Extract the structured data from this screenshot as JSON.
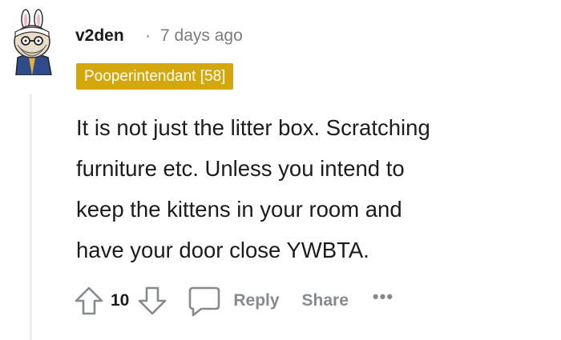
{
  "comment": {
    "author": "v2den",
    "separator": "·",
    "timestamp": "7 days ago",
    "flair": "Pooperintendant [58]",
    "body_lines": [
      "It is not just the litter box. Scratching",
      "furniture etc. Unless you intend to",
      "keep the kittens in your room and",
      "have your door close YWBTA."
    ]
  },
  "actions": {
    "score": "10",
    "reply_label": "Reply",
    "share_label": "Share",
    "more_label": "•••"
  },
  "colors": {
    "flair_bg": "#d4a80c",
    "muted_text": "#878a8c",
    "thread_line": "#ededed"
  },
  "icons": [
    "avatar-image",
    "upvote-icon",
    "downvote-icon",
    "comment-bubble-icon",
    "more-icon"
  ]
}
